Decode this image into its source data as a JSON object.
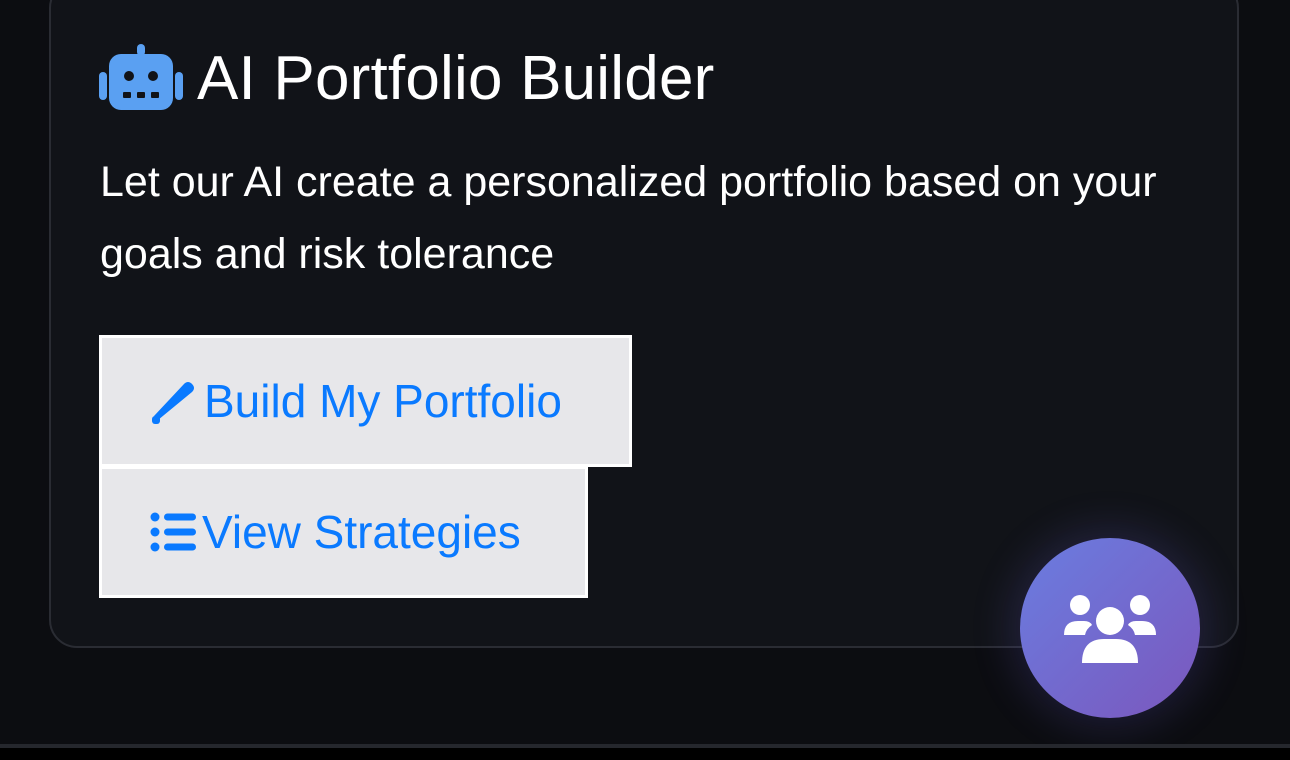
{
  "card": {
    "title": "AI Portfolio Builder",
    "title_icon": "robot-icon",
    "description": "Let our AI create a personalized portfolio based on your goals and risk tolerance"
  },
  "actions": {
    "build": {
      "label": "Build My Portfolio",
      "icon": "pencil-icon"
    },
    "strategies": {
      "label": "View Strategies",
      "icon": "list-icon"
    }
  },
  "fab": {
    "icon": "users-icon"
  },
  "colors": {
    "accent": "#0a7aff",
    "robot": "#5aa0f2",
    "fab_start": "#6a7de0",
    "fab_end": "#7b57bd",
    "background": "#0c0d11",
    "card": "#111318"
  }
}
